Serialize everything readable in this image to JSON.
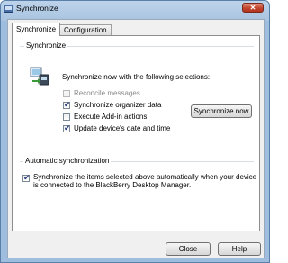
{
  "window": {
    "title": "Synchronize",
    "close_glyph": "✕"
  },
  "tabs": [
    {
      "label": "Synchronize",
      "selected": true
    },
    {
      "label": "Configuration",
      "selected": false
    }
  ],
  "synchronize_group": {
    "label": "Synchronize",
    "intro": "Synchronize now with the following selections:",
    "options": [
      {
        "label": "Reconcile messages",
        "checked": false,
        "enabled": false
      },
      {
        "label": "Synchronize organizer data",
        "checked": true,
        "enabled": true
      },
      {
        "label": "Execute Add-in actions",
        "checked": false,
        "enabled": true
      },
      {
        "label": "Update device's date and time",
        "checked": true,
        "enabled": true
      }
    ],
    "sync_now_label": "Synchronize now"
  },
  "auto_group": {
    "label": "Automatic synchronization",
    "option_line1": "Synchronize the items selected above automatically when your device",
    "option_line2": "is connected to the BlackBerry Desktop Manager.",
    "checked": true
  },
  "footer": {
    "close_label": "Close",
    "help_label": "Help"
  },
  "icons": {
    "title": "app-icon",
    "sync": "sync-devices-icon",
    "check": "check-icon"
  },
  "colors": {
    "titlebar": "#a9c3e0",
    "close_button": "#c2442d",
    "check_mark": "#2a3f78"
  }
}
